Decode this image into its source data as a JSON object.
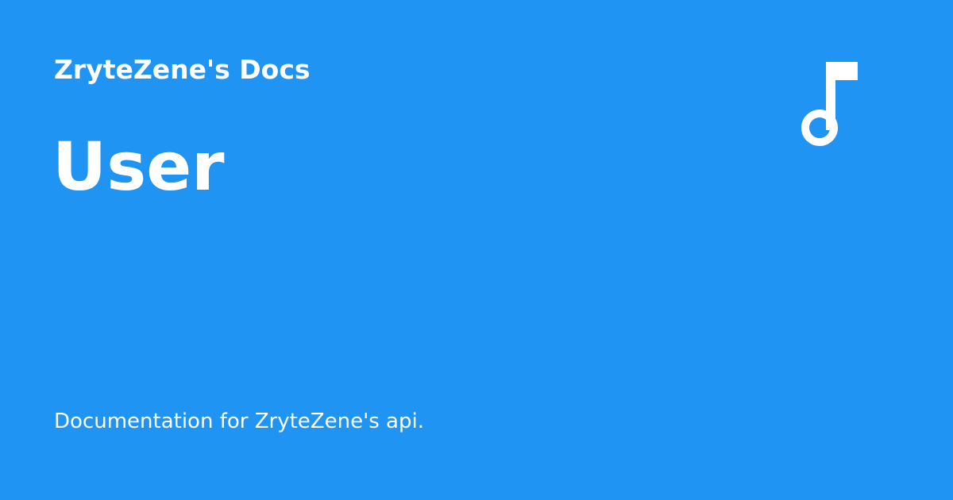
{
  "site": {
    "name": "ZryteZene's Docs"
  },
  "page": {
    "title": "User",
    "description": "Documentation for ZryteZene's api."
  },
  "logo": {
    "icon": "music-note-icon",
    "color": "#ffffff"
  },
  "theme": {
    "background": "#2094f3",
    "text": "#ffffff"
  }
}
